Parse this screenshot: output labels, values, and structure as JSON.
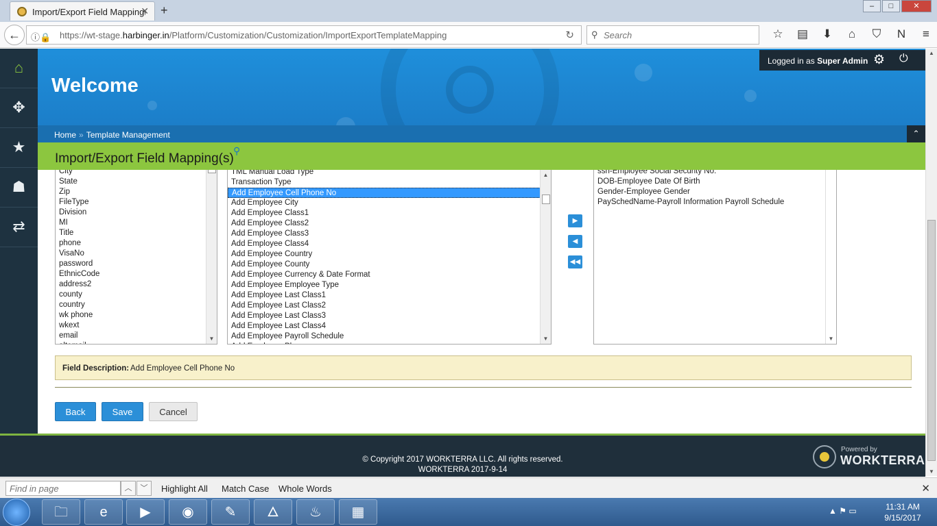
{
  "browser": {
    "tab_title": "Import/Export Field Mapping(",
    "url_prefix": "https://wt-stage.",
    "url_domain": "harbinger.in",
    "url_path": "/Platform/Customization/Customization/ImportExportTemplateMapping",
    "search_placeholder": "Search"
  },
  "sidebar": {
    "items": [
      {
        "icon": "home-icon",
        "glyph": "⌂"
      },
      {
        "icon": "puzzle-icon",
        "glyph": "✥"
      },
      {
        "icon": "user-star-icon",
        "glyph": "★"
      },
      {
        "icon": "user-icon",
        "glyph": "☗"
      },
      {
        "icon": "transfer-icon",
        "glyph": "⇄"
      }
    ]
  },
  "header": {
    "welcome": "Welcome",
    "logged_in_prefix": "Logged in as",
    "user_name": "Super Admin",
    "breadcrumb_home": "Home",
    "breadcrumb_sep": "»",
    "breadcrumb_current": "Template Management",
    "page_title": "Import/Export Field Mapping(s)"
  },
  "left_list": {
    "items": [
      "City",
      "State",
      "Zip",
      "FileType",
      "Division",
      "MI",
      "Title",
      "phone",
      "VisaNo",
      "password",
      "EthnicCode",
      "address2",
      "county",
      "country",
      "wk phone",
      "wkext",
      "email",
      "altemail"
    ]
  },
  "middle_list": {
    "selected": "Add Employee Cell Phone No",
    "items": [
      "TML Manual Load Type",
      "Transaction Type",
      "Add Employee Cell Phone No",
      "Add Employee City",
      "Add Employee Class1",
      "Add Employee Class2",
      "Add Employee Class3",
      "Add Employee Class4",
      "Add Employee Country",
      "Add Employee County",
      "Add Employee Currency & Date Format",
      "Add Employee Employee Type",
      "Add Employee Last Class1",
      "Add Employee Last Class2",
      "Add Employee Last Class3",
      "Add Employee Last Class4",
      "Add Employee Payroll Schedule",
      "Add Employee Phone"
    ]
  },
  "right_list": {
    "items": [
      "ssn-Employee Social Security No.",
      "DOB-Employee Date Of Birth",
      "Gender-Employee Gender",
      "PaySchedName-Payroll Information Payroll Schedule"
    ]
  },
  "field_description": {
    "label": "Field Description:",
    "value": "Add Employee Cell Phone No"
  },
  "buttons": {
    "back": "Back",
    "save": "Save",
    "cancel": "Cancel"
  },
  "footer": {
    "copyright": "© Copyright 2017 WORKTERRA LLC. All rights reserved.",
    "version": "WORKTERRA 2017-9-14",
    "powered_by": "Powered by",
    "brand": "WORKTERRA"
  },
  "findbar": {
    "placeholder": "Find in page",
    "highlight_all": "Highlight All",
    "match_case": "Match Case",
    "whole_words": "Whole Words"
  },
  "taskbar": {
    "time": "11:31 AM",
    "date": "9/15/2017"
  },
  "colors": {
    "accent_blue": "#1f8fdb",
    "accent_green": "#8cc63f",
    "sidebar_dark": "#1e3240",
    "selection_blue": "#3399ff"
  }
}
